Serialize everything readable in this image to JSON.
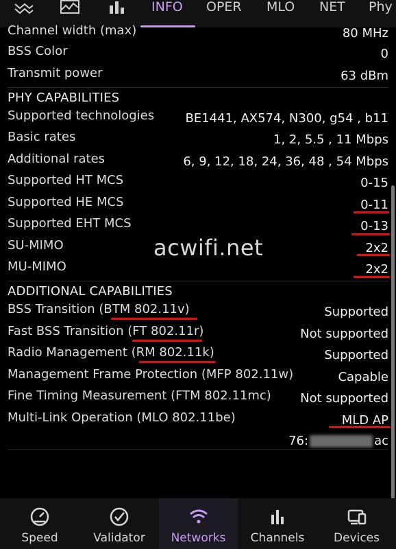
{
  "top_tabs": {
    "icons": [
      "signal-strength-icon",
      "activity-chart-icon",
      "bar-chart-icon"
    ],
    "tabs": [
      "INFO",
      "OPER",
      "MLO",
      "NET",
      "Phy"
    ],
    "active_tab": "INFO"
  },
  "rows_top": [
    {
      "label": "Channel width (max)",
      "value": "80 MHz"
    },
    {
      "label": "BSS Color",
      "value": "0"
    },
    {
      "label": "Transmit power",
      "value": "63 dBm"
    }
  ],
  "phy": {
    "title": "PHY CAPABILITIES",
    "rows": [
      {
        "label": "Supported technologies",
        "value": "BE1441, AX574, N300, g54 , b11"
      },
      {
        "label": "Basic rates",
        "value": "1, 2, 5.5 , 11 Mbps"
      },
      {
        "label": "Additional rates",
        "value": "6, 9, 12, 18, 24, 36, 48 , 54 Mbps"
      },
      {
        "label": "Supported HT MCS",
        "value": "0-15"
      },
      {
        "label": "Supported HE MCS",
        "value": "0-11"
      },
      {
        "label": "Supported EHT MCS",
        "value": "0-13"
      },
      {
        "label": "SU-MIMO",
        "value": "2x2"
      },
      {
        "label": "MU-MIMO",
        "value": "2x2"
      }
    ]
  },
  "additional": {
    "title": "ADDITIONAL CAPABILITIES",
    "rows": [
      {
        "label": "BSS Transition (BTM 802.11v)",
        "value": "Supported"
      },
      {
        "label": "Fast BSS Transition (FT 802.11r)",
        "value": "Not supported"
      },
      {
        "label": "Radio Management (RM 802.11k)",
        "value": "Supported"
      },
      {
        "label": "Management Frame Protection (MFP 802.11w)",
        "value": "Capable"
      },
      {
        "label": "Fine Timing Measurement (FTM 802.11mc)",
        "value": "Not supported"
      },
      {
        "label": "Multi-Link Operation (MLO 802.11be)",
        "value": "MLD AP"
      }
    ],
    "mac_prefix": "76:",
    "mac_suffix": "ac"
  },
  "watermark": "acwifi.net",
  "colors": {
    "accent": "#c79bf2",
    "highlight": "#e01010",
    "background": "#000000"
  },
  "bottom_nav": {
    "items": [
      {
        "label": "Speed",
        "icon": "speedometer-icon"
      },
      {
        "label": "Validator",
        "icon": "check-circle-icon"
      },
      {
        "label": "Networks",
        "icon": "wifi-icon"
      },
      {
        "label": "Channels",
        "icon": "bar-chart-icon"
      },
      {
        "label": "Devices",
        "icon": "devices-icon"
      }
    ],
    "active": "Networks"
  }
}
